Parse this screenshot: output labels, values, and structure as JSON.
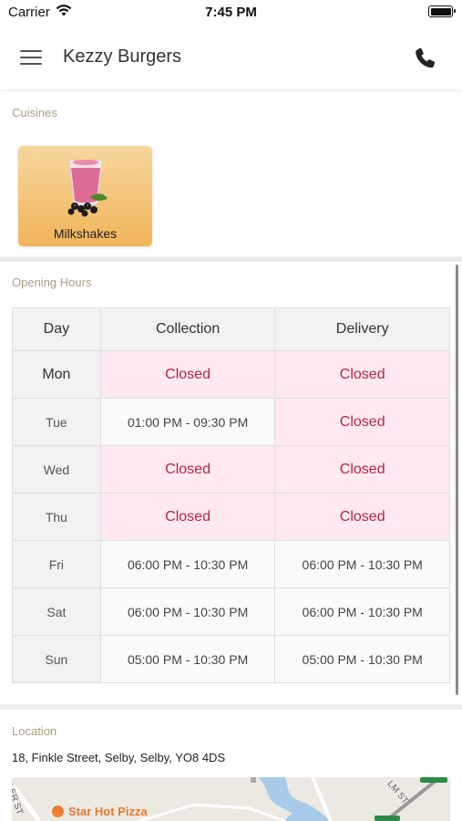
{
  "status_bar": {
    "carrier": "Carrier",
    "time": "7:45 PM"
  },
  "app_bar": {
    "title": "Kezzy Burgers"
  },
  "cuisines": {
    "label": "Cuisines",
    "items": [
      {
        "name": "Milkshakes"
      }
    ]
  },
  "opening_hours": {
    "label": "Opening Hours",
    "headers": [
      "Day",
      "Collection",
      "Delivery"
    ],
    "rows": [
      {
        "day": "Mon",
        "collection": "Closed",
        "delivery": "Closed"
      },
      {
        "day": "Tue",
        "collection": "01:00 PM - 09:30 PM",
        "delivery": "Closed"
      },
      {
        "day": "Wed",
        "collection": "Closed",
        "delivery": "Closed"
      },
      {
        "day": "Thu",
        "collection": "Closed",
        "delivery": "Closed"
      },
      {
        "day": "Fri",
        "collection": "06:00 PM - 10:30 PM",
        "delivery": "06:00 PM - 10:30 PM"
      },
      {
        "day": "Sat",
        "collection": "06:00 PM - 10:30 PM",
        "delivery": "06:00 PM - 10:30 PM"
      },
      {
        "day": "Sun",
        "collection": "05:00 PM - 10:30 PM",
        "delivery": "05:00 PM - 10:30 PM"
      }
    ]
  },
  "location": {
    "label": "Location",
    "address": "18, Finkle Street, Selby, Selby, YO8 4DS",
    "map": {
      "poi": "Star Hot Pizza",
      "street_labels": [
        "LER ST",
        "LM ST"
      ]
    }
  },
  "colors": {
    "closed_text": "#b8234f",
    "closed_bg": "#fde9ee",
    "section_label": "#a8a084",
    "card_gradient_top": "#f6d79d",
    "card_gradient_bottom": "#f1b45a"
  }
}
